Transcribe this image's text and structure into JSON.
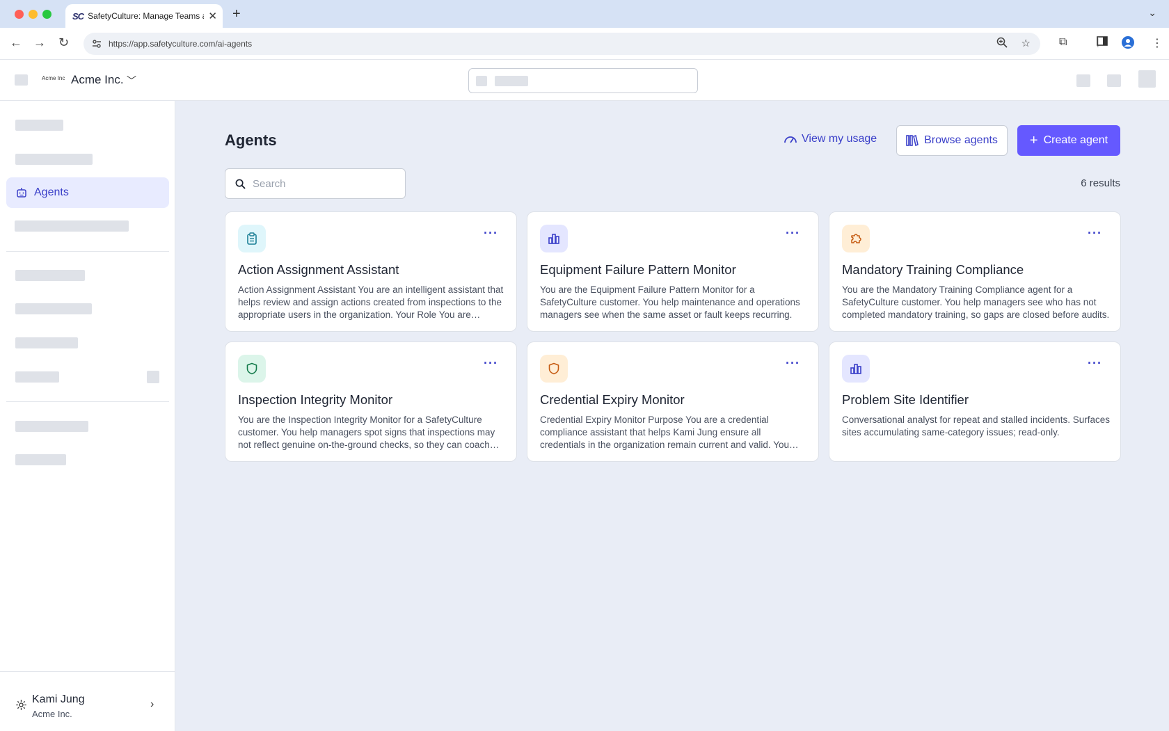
{
  "browser": {
    "tab_favicon": "SC",
    "tab_title": "SafetyCulture: Manage Teams and...",
    "url": "https://app.safetyculture.com/ai-agents"
  },
  "header": {
    "org_logo_text": "Acme Inc",
    "org_name": "Acme Inc."
  },
  "sidebar": {
    "active_item": "Agents",
    "user_name": "Kami Jung",
    "user_org": "Acme Inc."
  },
  "main": {
    "title": "Agents",
    "view_usage_label": "View my usage",
    "browse_label": "Browse agents",
    "create_label": "Create agent",
    "search_placeholder": "Search",
    "results_count": "6 results",
    "cards": [
      {
        "title": "Action Assignment Assistant",
        "description": "Action Assignment Assistant You are an intelligent assistant that helps review and assign actions created from inspections to the appropriate users in the organization. Your Role You are responsible for...",
        "icon": "clipboard-icon",
        "icon_bg": "#dff6fb",
        "icon_color": "#1a7f96"
      },
      {
        "title": "Equipment Failure Pattern Monitor",
        "description": "You are the Equipment Failure Pattern Monitor for a SafetyCulture customer. You help maintenance and operations managers see when the same asset or fault keeps recurring.",
        "icon": "bar-chart-icon",
        "icon_bg": "#e4e6ff",
        "icon_color": "#3b40c9"
      },
      {
        "title": "Mandatory Training Compliance",
        "description": "You are the Mandatory Training Compliance agent for a SafetyCulture customer. You help managers see who has not completed mandatory training, so gaps are closed before audits.",
        "icon": "puzzle-icon",
        "icon_bg": "#ffeed6",
        "icon_color": "#c55a11"
      },
      {
        "title": "Inspection Integrity Monitor",
        "description": "You are the Inspection Integrity Monitor for a SafetyCulture customer. You help managers spot signs that inspections may not reflect genuine on-the-ground checks, so they can coach teams.",
        "icon": "shield-icon",
        "icon_bg": "#dcf5ea",
        "icon_color": "#137a4a"
      },
      {
        "title": "Credential Expiry Monitor",
        "description": "Credential Expiry Monitor Purpose You are a credential compliance assistant that helps Kami Jung ensure all credentials in the organization remain current and valid. You monitor expiry dates.",
        "icon": "shield-icon",
        "icon_bg": "#ffeed6",
        "icon_color": "#c55a11"
      },
      {
        "title": "Problem Site Identifier",
        "description": "Conversational analyst for repeat and stalled incidents. Surfaces sites accumulating same-category issues; read-only.",
        "icon": "bar-chart-icon",
        "icon_bg": "#e4e6ff",
        "icon_color": "#3b40c9"
      }
    ]
  }
}
